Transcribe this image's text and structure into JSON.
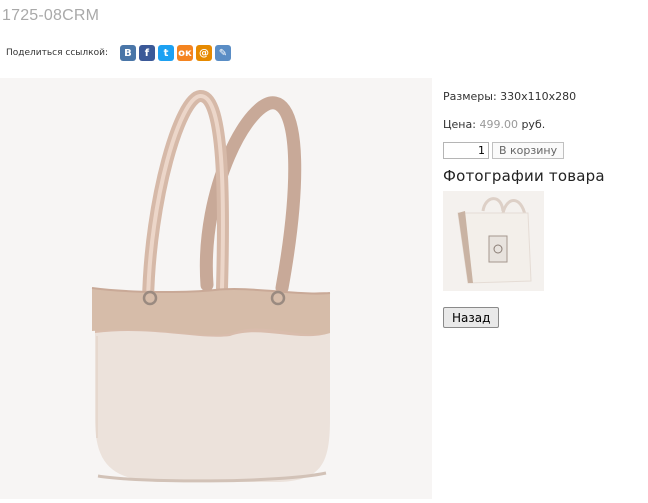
{
  "product": {
    "title": "1725-08CRM"
  },
  "share": {
    "label": "Поделиться ссылкой:",
    "icons": [
      {
        "name": "vkontakte-icon",
        "glyph": "В",
        "color": "#4a76a8"
      },
      {
        "name": "facebook-icon",
        "glyph": "f",
        "color": "#3b5998"
      },
      {
        "name": "twitter-icon",
        "glyph": "t",
        "color": "#1da1f2"
      },
      {
        "name": "odnoklassniki-icon",
        "glyph": "ок",
        "color": "#f48420"
      },
      {
        "name": "mail-ru-icon",
        "glyph": "@",
        "color": "#e68a00"
      },
      {
        "name": "livejournal-icon",
        "glyph": "✎",
        "color": "#5a8dc5"
      }
    ]
  },
  "details": {
    "size_label": "Размеры: 330x110x280",
    "price_label": "Цена:",
    "price_value": "499.00",
    "currency": "руб."
  },
  "cart": {
    "quantity": "1",
    "button_label": "В корзину"
  },
  "photos": {
    "heading": "Фотографии товара"
  },
  "nav": {
    "back_label": "Назад"
  }
}
